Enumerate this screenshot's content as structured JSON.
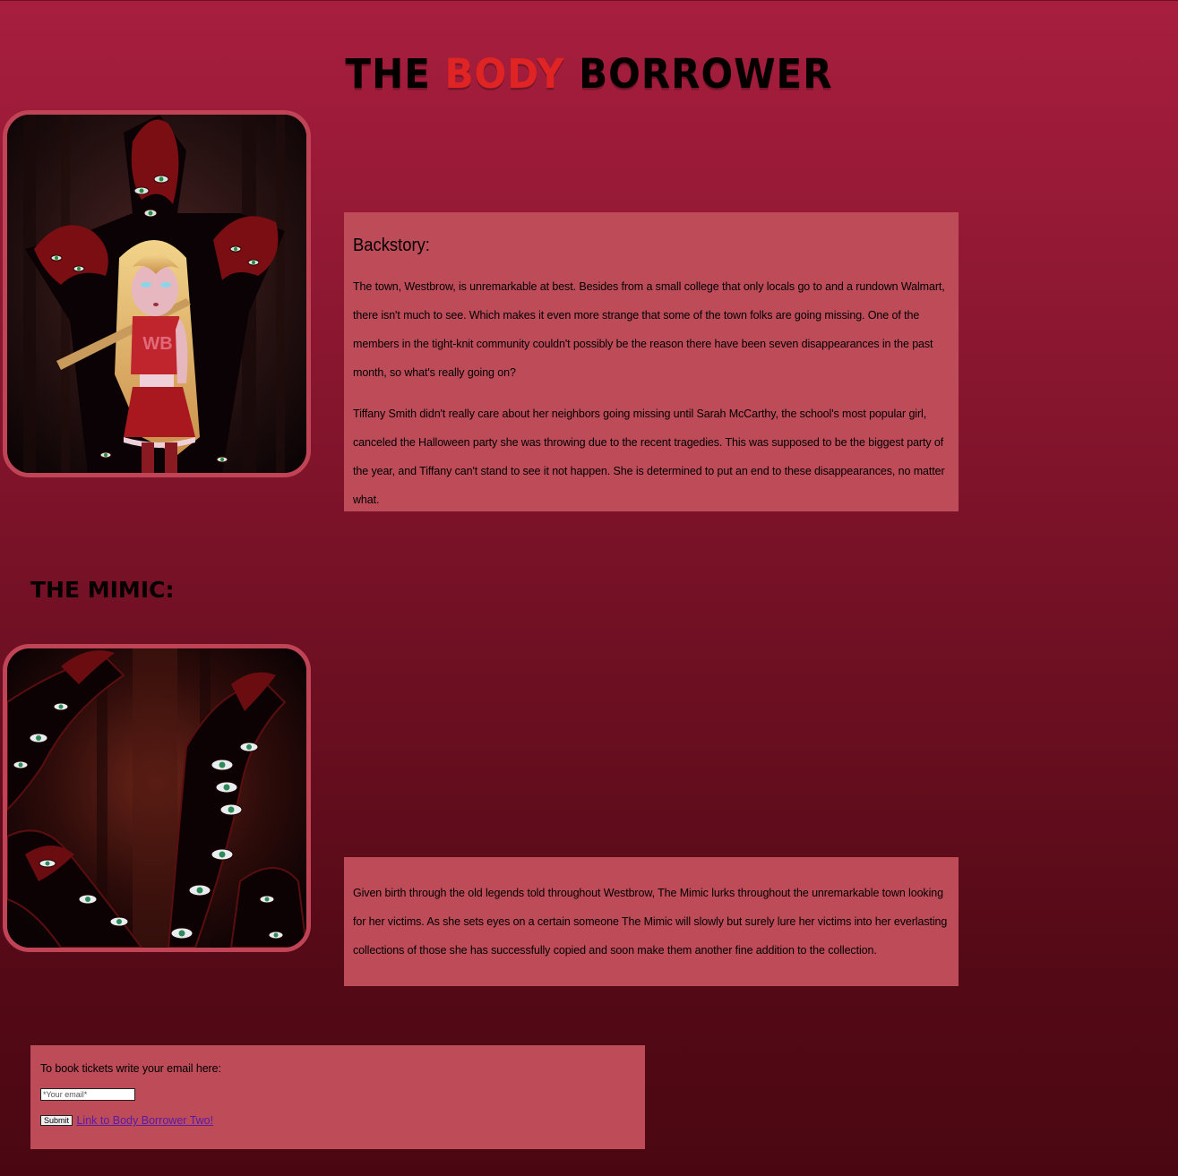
{
  "header": {
    "title_part1": "THE ",
    "title_accent": "BODY",
    "title_part2": " BORROWER"
  },
  "backstory": {
    "heading": "Backstory:",
    "paragraphs": [
      "The town, Westbrow, is unremarkable at best. Besides from a small college that only locals go to and a rundown Walmart, there isn't much to see. Which makes it even more strange that some of the town folks are going missing. One of the members in the tight-knit community couldn't possibly be the reason there have been seven disappearances in the past month, so what's really going on?",
      "Tiffany Smith didn't really care about her neighbors going missing until Sarah McCarthy, the school's most popular girl, canceled the Halloween party she was throwing due to the recent tragedies. This was supposed to be the biggest party of the year, and Tiffany can't stand to see it not happen. She is determined to put an end to these disappearances, no matter what."
    ]
  },
  "mimic": {
    "heading": "THE MIMIC:",
    "description": "Given birth through the old legends told throughout Westbrow, The Mimic lurks throughout the unremarkable town looking for her victims. As she sets eyes on a certain someone The Mimic will slowly but surely lure her victims into her everlasting collections of those she has successfully copied and soon make them another fine addition to the collection."
  },
  "tickets": {
    "prompt": "To book tickets write your email here:",
    "email_placeholder": "*Your email*",
    "submit_label": "Submit",
    "link_label": "Link to Body Borrower Two!"
  },
  "art": {
    "tiffany_shirt_text": "WB"
  },
  "colors": {
    "title_accent": "#e02424",
    "panel_background": "#bd4c58",
    "image_border": "#c04455",
    "link": "#5a1aa8"
  }
}
